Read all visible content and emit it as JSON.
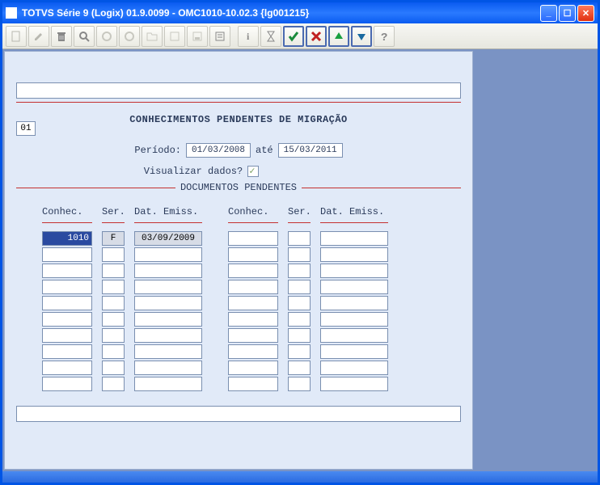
{
  "window": {
    "title": "TOTVS Série 9  (Logix) 01.9.0099 - OMC1010-10.02.3  {lg001215}"
  },
  "form": {
    "code": "01",
    "heading": "CONHECIMENTOS PENDENTES DE MIGRAÇÃO",
    "period_label": "Período:",
    "period_from": "01/03/2008",
    "period_mid": "até",
    "period_to": "15/03/2011",
    "viz_label": "Visualizar dados?",
    "viz_checked": true,
    "section_label": "DOCUMENTOS PENDENTES",
    "columns": {
      "c1": "Conhec.",
      "c2": "Ser.",
      "c3": "Dat. Emiss."
    }
  },
  "left_rows": [
    {
      "conhec": "1010",
      "ser": "F",
      "dat": "03/09/2009",
      "selected": true
    },
    {
      "conhec": "",
      "ser": "",
      "dat": ""
    },
    {
      "conhec": "",
      "ser": "",
      "dat": ""
    },
    {
      "conhec": "",
      "ser": "",
      "dat": ""
    },
    {
      "conhec": "",
      "ser": "",
      "dat": ""
    },
    {
      "conhec": "",
      "ser": "",
      "dat": ""
    },
    {
      "conhec": "",
      "ser": "",
      "dat": ""
    },
    {
      "conhec": "",
      "ser": "",
      "dat": ""
    },
    {
      "conhec": "",
      "ser": "",
      "dat": ""
    },
    {
      "conhec": "",
      "ser": "",
      "dat": ""
    }
  ],
  "right_rows": [
    {
      "conhec": "",
      "ser": "",
      "dat": ""
    },
    {
      "conhec": "",
      "ser": "",
      "dat": ""
    },
    {
      "conhec": "",
      "ser": "",
      "dat": ""
    },
    {
      "conhec": "",
      "ser": "",
      "dat": ""
    },
    {
      "conhec": "",
      "ser": "",
      "dat": ""
    },
    {
      "conhec": "",
      "ser": "",
      "dat": ""
    },
    {
      "conhec": "",
      "ser": "",
      "dat": ""
    },
    {
      "conhec": "",
      "ser": "",
      "dat": ""
    },
    {
      "conhec": "",
      "ser": "",
      "dat": ""
    },
    {
      "conhec": "",
      "ser": "",
      "dat": ""
    }
  ],
  "toolbar_icons": [
    "new",
    "edit",
    "delete",
    "search",
    "first",
    "prev",
    "open",
    "save",
    "save-as",
    "find",
    "info",
    "hourglass",
    "confirm",
    "cancel",
    "up",
    "down",
    "help"
  ]
}
